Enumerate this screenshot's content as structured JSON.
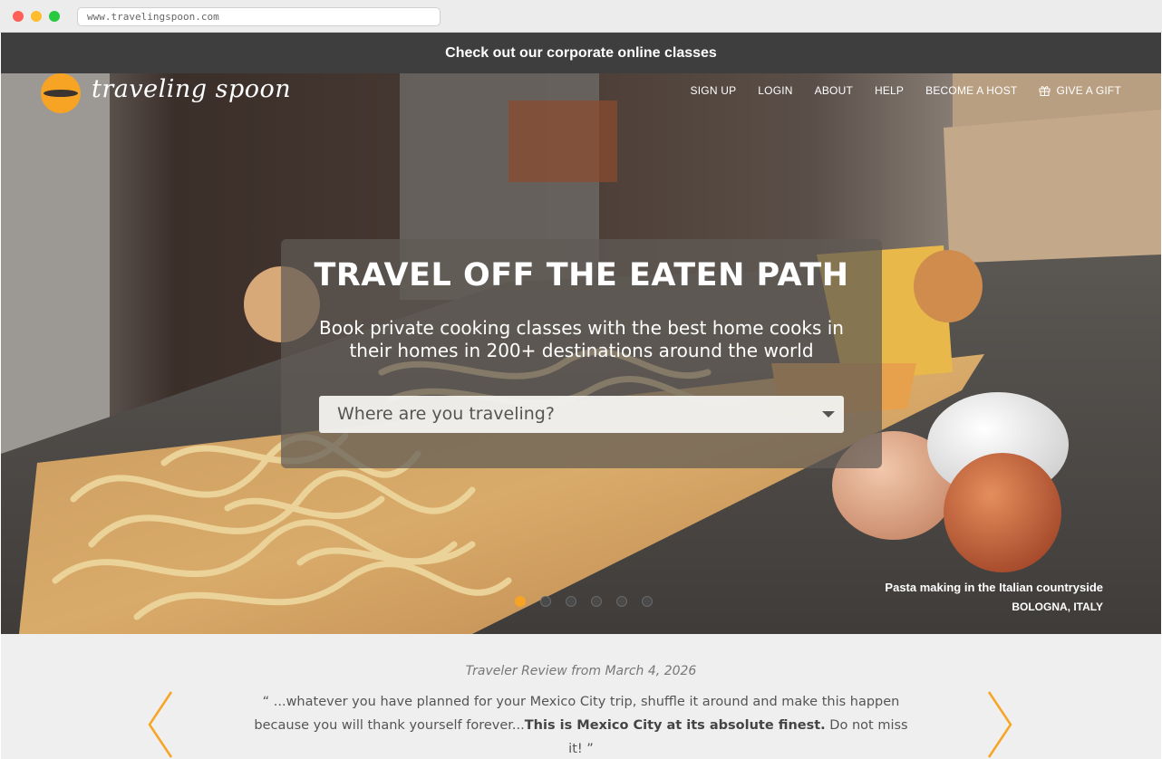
{
  "browser": {
    "url": "www.travelingspoon.com"
  },
  "announcement": {
    "text": "Check out our corporate online classes"
  },
  "header": {
    "logo_text": "traveling spoon",
    "nav": [
      {
        "label": "SIGN UP"
      },
      {
        "label": "LOGIN"
      },
      {
        "label": "ABOUT"
      },
      {
        "label": "HELP"
      },
      {
        "label": "BECOME A HOST"
      },
      {
        "label": "GIVE A GIFT",
        "icon": "gift-icon"
      }
    ]
  },
  "hero": {
    "title": "TRAVEL OFF THE EATEN PATH",
    "subtitle": "Book private cooking classes with the best home cooks in their homes in 200+ destinations around the world",
    "search_placeholder": "Where are you traveling?",
    "caption_title": "Pasta making in the Italian countryside",
    "caption_location": "BOLOGNA, ITALY",
    "slides_total": 6,
    "slide_active": 1
  },
  "review": {
    "date_line": "Traveler Review from March 4, 2026",
    "quote_open": "“ ...whatever you have planned for your Mexico City trip, shuffle it around and make this happen because you will thank yourself forever...",
    "quote_bold": "This is Mexico City at its absolute finest.",
    "quote_close": " Do not miss it! ”"
  },
  "colors": {
    "brand_orange": "#f7a425",
    "announcement_bg": "#3f3e3f",
    "review_bg": "#efefef"
  }
}
